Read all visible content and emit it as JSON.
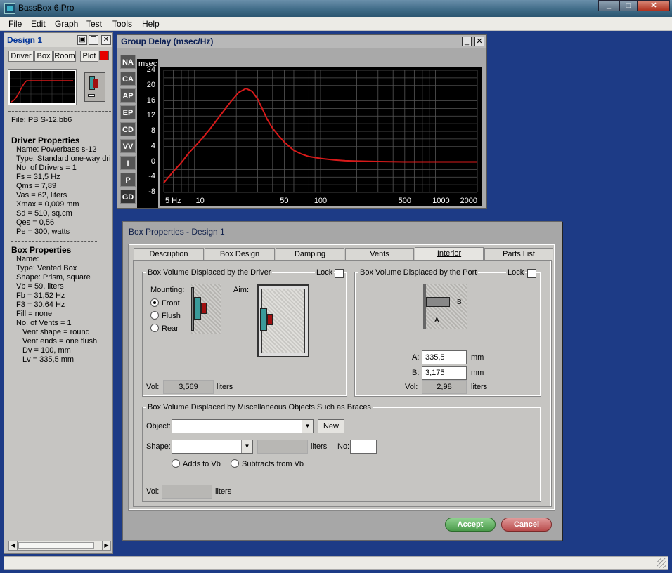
{
  "app": {
    "title": "BassBox 6 Pro"
  },
  "menu": [
    "File",
    "Edit",
    "Graph",
    "Test",
    "Tools",
    "Help"
  ],
  "design_panel": {
    "title": "Design 1",
    "tabs": [
      "Driver",
      "Box",
      "Room",
      "Plot"
    ],
    "plot_color": "#e60000",
    "file_label": "File: PB S-12.bb6",
    "driver_heading": "Driver Properties",
    "driver_lines": [
      "Name: Powerbass s-12",
      "Type: Standard one-way driver",
      "No. of Drivers = 1",
      "Fs = 31,5 Hz",
      "Qms = 7,89",
      "Vas = 62, liters",
      "Xmax = 0,009 mm",
      "Sd = 510, sq.cm",
      "Qes = 0,56",
      "Pe = 300, watts"
    ],
    "box_heading": "Box Properties",
    "box_lines": [
      "Name:",
      "Type: Vented Box",
      "Shape: Prism, square",
      "Vb = 59, liters",
      "Fb = 31,52 Hz",
      "F3 = 30,64 Hz",
      "Fill = none",
      "No. of Vents = 1"
    ],
    "vent_lines": [
      "Vent shape = round",
      "Vent ends = one flush",
      "Dv = 100, mm",
      "Lv = 335,5 mm"
    ]
  },
  "group_delay": {
    "title": "Group Delay (msec/Hz)",
    "side_buttons": [
      "NA",
      "CA",
      "AP",
      "EP",
      "CD",
      "VV",
      "I",
      "P",
      "GD"
    ],
    "unit_label": "msec",
    "curve_color": "#d81a1a"
  },
  "chart_data": {
    "type": "line",
    "title": "Group Delay (msec/Hz)",
    "ylabel": "msec",
    "xlabel": "",
    "x_scale": "log",
    "xlim": [
      5,
      2000
    ],
    "ylim": [
      -8,
      24
    ],
    "x_ticks": [
      "5 Hz",
      "10",
      "50",
      "100",
      "500",
      "1000",
      "2000"
    ],
    "y_ticks": [
      "24",
      "20",
      "16",
      "12",
      "8",
      "4",
      "0",
      "-4",
      "-8"
    ],
    "grid": true,
    "series": [
      {
        "x": [
          5,
          6,
          7,
          8,
          10,
          12,
          15,
          18,
          21,
          24,
          27,
          30,
          33,
          36,
          40,
          45,
          50,
          60,
          70,
          80,
          100,
          130,
          160,
          200,
          300,
          500,
          800,
          1000,
          1500,
          2000
        ],
        "values": [
          -5.5,
          -2.5,
          -0.2,
          2.2,
          5.5,
          8.5,
          12.5,
          15.8,
          18.2,
          19.2,
          18.5,
          16.5,
          13.8,
          11.2,
          8.8,
          6.8,
          5.2,
          3.0,
          2.0,
          1.4,
          0.9,
          0.5,
          0.3,
          0.2,
          0.1,
          0.0,
          0.0,
          0.0,
          0.0,
          0.0
        ]
      }
    ]
  },
  "dialog": {
    "title": "Box Properties - Design 1",
    "tabs": [
      "Description",
      "Box Design",
      "Damping",
      "Vents",
      "Interior",
      "Parts List"
    ],
    "active_tab": "Interior",
    "driver_group": {
      "title": "Box Volume Displaced by the Driver",
      "lock_label": "Lock",
      "mounting_label": "Mounting:",
      "aim_label": "Aim:",
      "options": [
        "Front",
        "Flush",
        "Rear"
      ],
      "selected": "Front",
      "vol_label": "Vol:",
      "vol_value": "3,569",
      "vol_unit": "liters"
    },
    "port_group": {
      "title": "Box Volume Displaced by the Port",
      "lock_label": "Lock",
      "a_label": "A:",
      "a_value": "335,5",
      "b_label": "B:",
      "b_value": "3,175",
      "unit": "mm",
      "vol_label": "Vol:",
      "vol_value": "2,98",
      "vol_unit": "liters",
      "diagram_a": "A",
      "diagram_b": "B"
    },
    "misc_group": {
      "title": "Box Volume Displaced by Miscellaneous Objects Such as Braces",
      "object_label": "Object:",
      "object_value": "",
      "new_label": "New",
      "shape_label": "Shape:",
      "shape_value": "",
      "liters_label": "liters",
      "no_label": "No:",
      "no_value": "",
      "adds_label": "Adds to Vb",
      "subtracts_label": "Subtracts from Vb",
      "vol_label": "Vol:",
      "vol_unit": "liters"
    },
    "accept_label": "Accept",
    "cancel_label": "Cancel",
    "accept_color": "#5aa85a",
    "cancel_color": "#c85a5a"
  }
}
